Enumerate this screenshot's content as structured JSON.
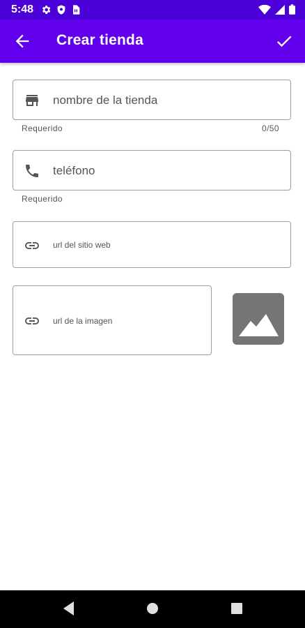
{
  "status_bar": {
    "time": "5:48",
    "icons_left": [
      "settings-icon",
      "shield-icon",
      "sim-card-icon"
    ],
    "icons_right": [
      "wifi-icon",
      "signal-icon",
      "battery-icon"
    ]
  },
  "app_bar": {
    "title": "Crear tienda",
    "back_icon": "arrow-back-icon",
    "confirm_icon": "check-icon",
    "color": "#6200ee"
  },
  "form": {
    "store_name": {
      "icon": "store-icon",
      "placeholder": "nombre de la tienda",
      "value": "",
      "helper": "Requerido",
      "counter": "0/50"
    },
    "phone": {
      "icon": "phone-icon",
      "placeholder": "teléfono",
      "value": "",
      "helper": "Requerido"
    },
    "website": {
      "icon": "link-icon",
      "placeholder": "url del sitio web",
      "value": ""
    },
    "image_url": {
      "icon": "link-icon",
      "placeholder": "url de la imagen",
      "value": ""
    },
    "image_preview_icon": "image-placeholder-icon"
  },
  "nav_bar": {
    "icons": [
      "back-triangle-icon",
      "home-circle-icon",
      "recents-square-icon"
    ]
  }
}
